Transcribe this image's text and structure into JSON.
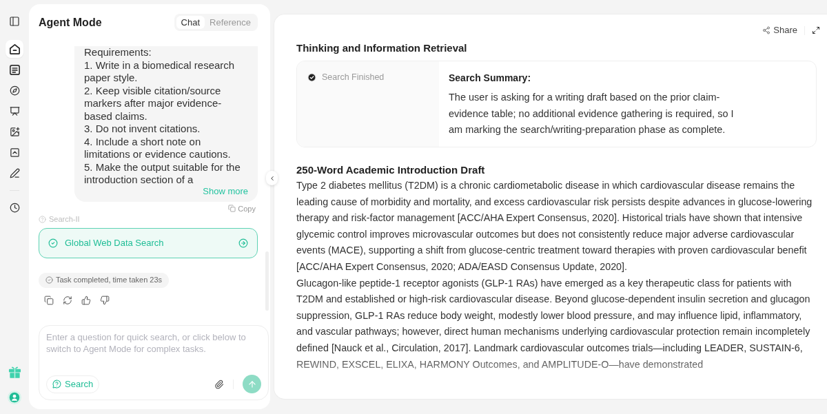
{
  "nav_items": [
    {
      "selected": true
    },
    {
      "selected": false
    },
    {
      "selected": false
    },
    {
      "selected": false
    },
    {
      "selected": false
    },
    {
      "selected": false
    },
    {
      "selected": false
    },
    {
      "selected": false
    }
  ],
  "left_panel": {
    "title": "Agent Mode",
    "tabs": [
      {
        "label": "Chat",
        "selected": true
      },
      {
        "label": "Reference",
        "selected": false
      }
    ],
    "message": {
      "text": "Requirements:\n1. Write in a biomedical research paper style.\n2. Keep visible citation/source markers after major evidence-based claims.\n3. Do not invent citations.\n4. Include a short note on limitations or evidence cautions.\n5. Make the output suitable for the introduction section of a",
      "show_more": "Show more",
      "copy": "Copy"
    },
    "step_label": "Search-II",
    "tool_card": {
      "label": "Global Web Data Search",
      "done": true
    },
    "status": "Task completed, time taken 23s",
    "composer": {
      "placeholder": "Enter a question for quick search, or click below to switch to Agent Mode for complex tasks.",
      "mode_button": "Search"
    }
  },
  "right_panel": {
    "share": "Share",
    "retrieval": {
      "heading": "Thinking and Information Retrieval",
      "status": "Search Finished",
      "summary_title": "Search Summary:",
      "summary_text": "The user is asking for a writing draft based on the prior claim-evidence table; no additional evidence gathering is required, so I am marking the search/writing-preparation phase as complete."
    },
    "draft": {
      "heading": "250-Word Academic Introduction Draft",
      "paragraphs": [
        "Type 2 diabetes mellitus (T2DM) is a chronic cardiometabolic disease in which cardiovascular disease remains the leading cause of morbidity and mortality, and excess cardiovascular risk persists despite advances in glucose-lowering therapy and risk-factor management [ACC/AHA Expert Consensus, 2020]. Historical trials have shown that intensive glycemic control improves microvascular outcomes but does not consistently reduce major adverse cardiovascular events (MACE), supporting a shift from glucose-centric treatment toward therapies with proven cardiovascular benefit [ACC/AHA Expert Consensus, 2020; ADA/EASD Consensus Update, 2020].",
        "Glucagon-like peptide-1 receptor agonists (GLP-1 RAs) have emerged as a key therapeutic class for patients with T2DM and established or high-risk cardiovascular disease. Beyond glucose-dependent insulin secretion and glucagon suppression, GLP-1 RAs reduce body weight, modestly lower blood pressure, and may influence lipid, inflammatory, and vascular pathways; however, direct human mechanisms underlying cardiovascular protection remain incompletely defined [Nauck et al., Circulation, 2017]. Landmark cardiovascular outcomes trials—including LEADER, SUSTAIN-6, REWIND, EXSCEL, ELIXA, HARMONY Outcomes, and AMPLITUDE-O—have demonstrated"
      ]
    }
  }
}
